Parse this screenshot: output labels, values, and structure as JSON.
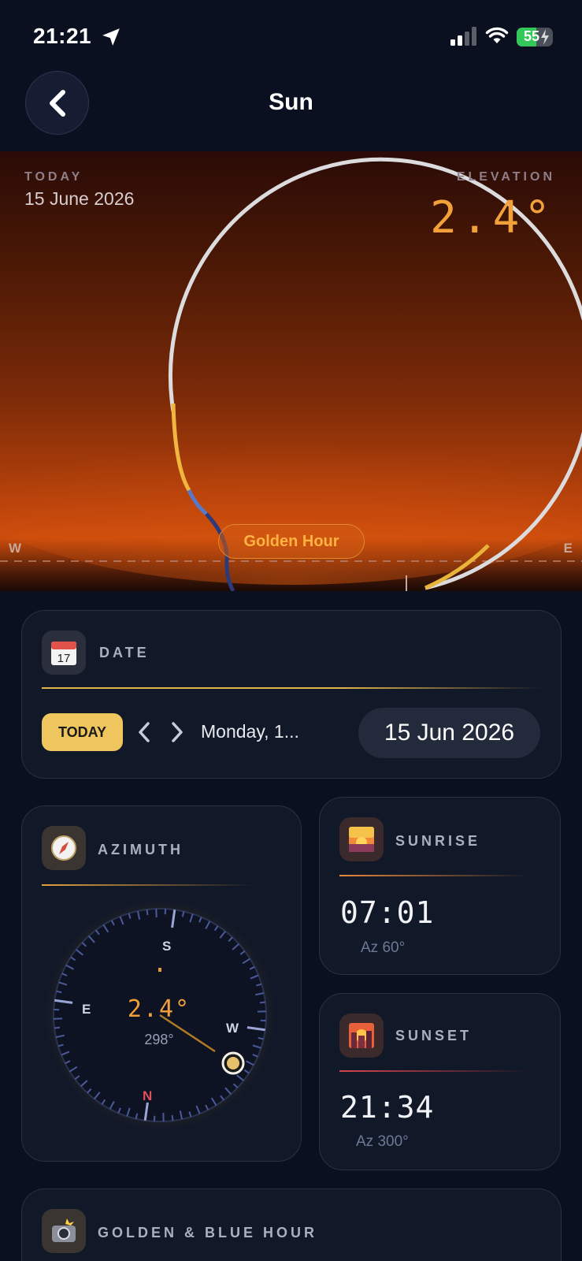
{
  "status_bar": {
    "time": "21:21",
    "battery": "55",
    "location_icon": "location-arrow-icon",
    "signal_icon": "cellular-signal-icon",
    "wifi_icon": "wifi-icon",
    "charging_icon": "bolt-icon"
  },
  "nav": {
    "back_icon": "chevron-left-icon",
    "title": "Sun"
  },
  "sky": {
    "today_caption": "TODAY",
    "today_date": "15 June 2026",
    "elevation_caption": "ELEVATION",
    "elevation_value": "2.4°",
    "phase_label": "Golden Hour",
    "west_label": "W",
    "east_label": "E"
  },
  "date_card": {
    "icon": "calendar-icon",
    "title": "DATE",
    "today_button": "TODAY",
    "prev_icon": "chevron-left-icon",
    "next_icon": "chevron-right-icon",
    "day_label": "Monday, 1...",
    "date_value": "15 Jun 2026"
  },
  "azimuth_card": {
    "icon": "compass-icon",
    "title": "AZIMUTH",
    "elevation": "2.4°",
    "azimuth": "298°",
    "labels": {
      "n": "N",
      "s": "S",
      "e": "E",
      "w": "W"
    }
  },
  "sunrise_card": {
    "icon": "sunrise-icon",
    "title": "SUNRISE",
    "time": "07:01",
    "azimuth": "Az 60°"
  },
  "sunset_card": {
    "icon": "sunset-icon",
    "title": "SUNSET",
    "time": "21:34",
    "azimuth": "Az 300°"
  },
  "golden_card": {
    "icon": "camera-flash-icon",
    "title": "GOLDEN & BLUE HOUR"
  },
  "colors": {
    "background": "#0b1020",
    "card": "#111828",
    "accent_orange": "#f2a13a",
    "today_button": "#efc65e",
    "sunset_line": "#d9454e"
  }
}
